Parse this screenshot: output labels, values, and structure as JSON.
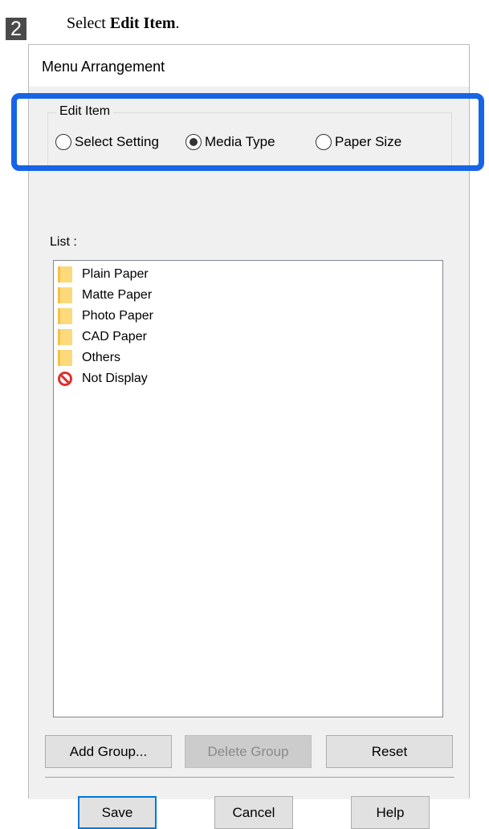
{
  "step": {
    "number": "2",
    "text_prefix": "Select ",
    "text_bold": "Edit Item",
    "text_suffix": "."
  },
  "dialog": {
    "title": "Menu Arrangement",
    "edit_item_group": {
      "legend": "Edit Item",
      "options": [
        {
          "label": "Select Setting",
          "checked": false
        },
        {
          "label": "Media Type",
          "checked": true
        },
        {
          "label": "Paper Size",
          "checked": false
        }
      ]
    },
    "list": {
      "label": "List :",
      "items": [
        {
          "label": "Plain Paper",
          "icon": "folder-icon"
        },
        {
          "label": "Matte Paper",
          "icon": "folder-icon"
        },
        {
          "label": "Photo Paper",
          "icon": "folder-icon"
        },
        {
          "label": "CAD Paper",
          "icon": "folder-icon"
        },
        {
          "label": "Others",
          "icon": "folder-icon"
        },
        {
          "label": "Not Display",
          "icon": "not-display-icon"
        }
      ]
    },
    "buttons": {
      "add_group": "Add Group...",
      "delete_group": "Delete Group",
      "reset": "Reset",
      "save": "Save",
      "cancel": "Cancel",
      "help": "Help"
    }
  },
  "colors": {
    "highlight": "#1565e6",
    "dialog_bg": "#f0f0f0",
    "default_button_border": "#0078d7"
  }
}
